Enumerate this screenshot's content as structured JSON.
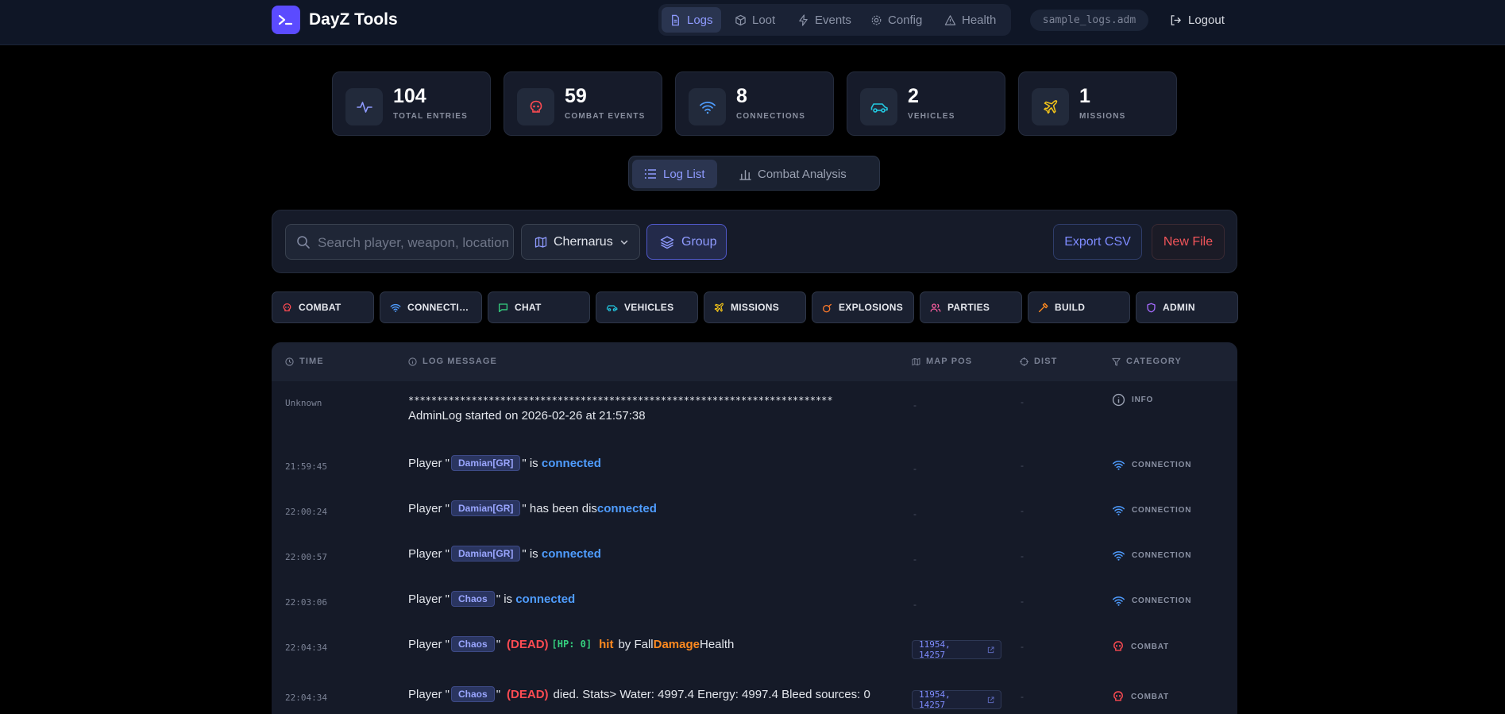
{
  "app": {
    "title": "DayZ Tools",
    "logo_glyph": ">_",
    "accent": "#5b4bff"
  },
  "nav": {
    "items": [
      {
        "label": "Logs",
        "icon": "file-text-icon",
        "active": true
      },
      {
        "label": "Loot",
        "icon": "box-icon"
      },
      {
        "label": "Events",
        "icon": "lightning-icon"
      },
      {
        "label": "Config",
        "icon": "gear-icon"
      },
      {
        "label": "Health",
        "icon": "warning-triangle-icon"
      }
    ],
    "file": "sample_logs.adm",
    "logout": "Logout"
  },
  "stats": [
    {
      "value": "104",
      "label": "TOTAL ENTRIES",
      "icon": "activity-icon",
      "color": "#8f9bff"
    },
    {
      "value": "59",
      "label": "COMBAT EVENTS",
      "icon": "skull-icon",
      "color": "#ff4b52"
    },
    {
      "value": "8",
      "label": "CONNECTIONS",
      "icon": "wifi-icon",
      "color": "#4f9dff"
    },
    {
      "value": "2",
      "label": "VEHICLES",
      "icon": "car-icon",
      "color": "#22c7e0"
    },
    {
      "value": "1",
      "label": "MISSIONS",
      "icon": "plane-icon",
      "color": "#f5c518"
    }
  ],
  "view_toggle": {
    "log_list": "Log List",
    "combat_analysis": "Combat Analysis"
  },
  "toolbar": {
    "search_placeholder": "Search player, weapon, location...",
    "map": "Chernarus",
    "group": "Group",
    "export": "Export CSV",
    "new_file": "New File"
  },
  "categories": [
    {
      "label": "COMBAT",
      "icon": "skull-icon",
      "color": "#ff4b52"
    },
    {
      "label": "CONNECTIONS",
      "display": "CONNECTIO...",
      "icon": "wifi-icon",
      "color": "#4f9dff"
    },
    {
      "label": "CHAT",
      "icon": "chat-icon",
      "color": "#35d07f"
    },
    {
      "label": "VEHICLES",
      "icon": "car-icon",
      "color": "#22c7e0"
    },
    {
      "label": "MISSIONS",
      "icon": "plane-icon",
      "color": "#f5c518"
    },
    {
      "label": "EXPLOSIONS",
      "icon": "bomb-icon",
      "color": "#ff7a2a"
    },
    {
      "label": "PARTIES",
      "icon": "users-icon",
      "color": "#ff5fa2"
    },
    {
      "label": "BUILD",
      "icon": "hammer-icon",
      "color": "#ff8a1f"
    },
    {
      "label": "ADMIN",
      "icon": "shield-icon",
      "color": "#a66bff"
    }
  ],
  "table": {
    "headers": {
      "time": "TIME",
      "message": "LOG MESSAGE",
      "map_pos": "MAP POS",
      "dist": "DIST",
      "category": "CATEGORY"
    },
    "rows": [
      {
        "time": "Unknown",
        "stars": "**************************************************************************",
        "text": "AdminLog started on 2026-02-26 at 21:57:38",
        "pos": "-",
        "dist": "-",
        "category": "INFO"
      },
      {
        "time": "21:59:45",
        "pre": "Player \"",
        "player": "Damian[GR]",
        "mid": "\" is ",
        "kw": "connected",
        "pos": "-",
        "dist": "-",
        "category": "CONNECTION"
      },
      {
        "time": "22:00:24",
        "pre": "Player \"",
        "player": "Damian[GR]",
        "mid": "\" has been dis",
        "kw": "connected",
        "pos": "-",
        "dist": "-",
        "category": "CONNECTION"
      },
      {
        "time": "22:00:57",
        "pre": "Player \"",
        "player": "Damian[GR]",
        "mid": "\" is ",
        "kw": "connected",
        "pos": "-",
        "dist": "-",
        "category": "CONNECTION"
      },
      {
        "time": "22:03:06",
        "pre": "Player \"",
        "player": "Chaos",
        "mid": "\" is ",
        "kw": "connected",
        "pos": "-",
        "dist": "-",
        "category": "CONNECTION"
      },
      {
        "time": "22:04:34",
        "pre": "Player \"",
        "player": "Chaos",
        "mid": "\"",
        "dead": "(DEAD)",
        "hp": "[HP: 0]",
        "hit": "hit",
        "by": "by Fall",
        "dmg": "Damage",
        "tail": "Health",
        "pos": "11954, 14257",
        "dist": "-",
        "category": "COMBAT"
      },
      {
        "time": "22:04:34",
        "pre": "Player \"",
        "player": "Chaos",
        "mid": "\"",
        "dead": "(DEAD)",
        "tail": "died. Stats> Water: 4997.4 Energy: 4997.4 Bleed sources: 0",
        "pos": "11954, 14257",
        "dist": "-",
        "category": "COMBAT"
      }
    ]
  }
}
